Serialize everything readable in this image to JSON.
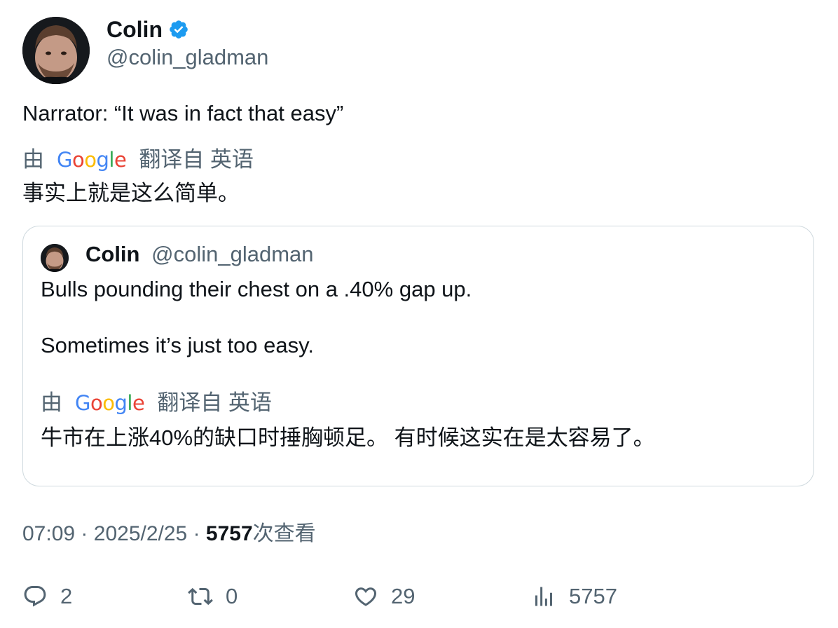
{
  "author": {
    "name": "Colin",
    "handle": "@colin_gladman",
    "verified": true
  },
  "tweet": {
    "text": "Narrator: “It was in fact that easy”",
    "translation": {
      "by": "由",
      "provider": "Google",
      "from_lang": "翻译自 英语",
      "text": "事实上就是这么简单。"
    }
  },
  "quoted": {
    "name": "Colin",
    "handle": "@colin_gladman",
    "line1": "Bulls pounding their chest on a .40% gap up.",
    "line2": "Sometimes it’s just too easy.",
    "translation": {
      "by": "由",
      "provider": "Google",
      "from_lang": "翻译自 英语",
      "text": "牛市在上涨40%的缺口时捶胸顿足。 有时候这实在是太容易了。"
    }
  },
  "meta": {
    "time": "07:09",
    "sep1": "·",
    "date": "2025/2/25",
    "sep2": "·",
    "views": "5757",
    "views_label": "次查看"
  },
  "actions": {
    "replies": "2",
    "retweets": "0",
    "likes": "29",
    "views": "5757"
  },
  "colors": {
    "text": "#0f1419",
    "secondary": "#536471",
    "verified": "#1d9bf0",
    "border": "#cfd9de",
    "google_blue": "#4285F4",
    "google_red": "#EA4335",
    "google_yellow": "#FBBC05",
    "google_green": "#34A853"
  }
}
